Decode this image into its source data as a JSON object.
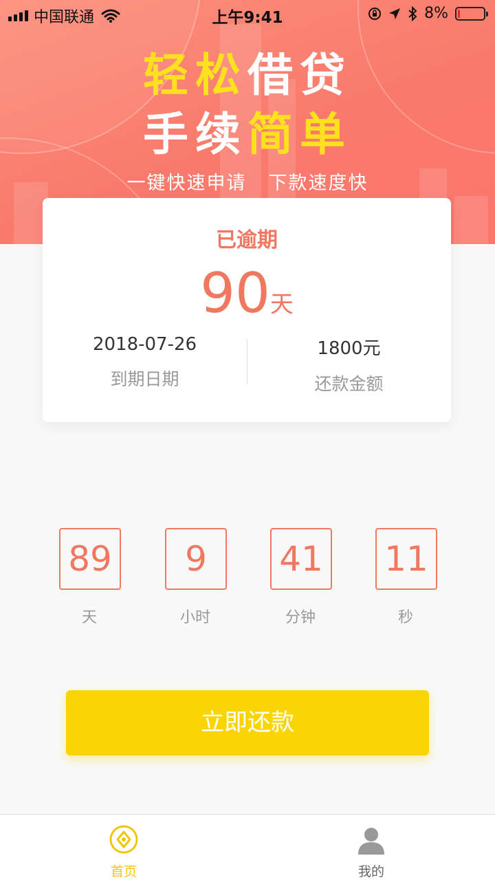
{
  "status_bar": {
    "carrier": "中国联通",
    "time": "上午9:41",
    "battery": "8%",
    "battery_level": 0.08,
    "icons": [
      "signal-icon",
      "wifi-icon",
      "lock-rotation-icon",
      "location-icon",
      "bluetooth-icon",
      "battery-icon"
    ]
  },
  "hero": {
    "line1": [
      "轻",
      "松",
      "借",
      "贷"
    ],
    "line2": [
      "手",
      "续",
      "简",
      "单"
    ],
    "subtitle_left": "一键快速申请",
    "subtitle_right": "下款速度快"
  },
  "loan_card": {
    "status": "已逾期",
    "overdue_days": "90",
    "days_unit": "天",
    "due_date": "2018-07-26",
    "due_date_label": "到期日期",
    "amount": "1800元",
    "amount_label": "还款金额"
  },
  "countdown": [
    {
      "value": "89",
      "label": "天"
    },
    {
      "value": "9",
      "label": "小时"
    },
    {
      "value": "41",
      "label": "分钟"
    },
    {
      "value": "11",
      "label": "秒"
    }
  ],
  "repay_button": "立即还款",
  "tabs": [
    {
      "label": "首页",
      "icon": "home-coin-icon",
      "active": true
    },
    {
      "label": "我的",
      "icon": "user-icon",
      "active": false
    }
  ],
  "colors": {
    "accent": "#f07860",
    "button": "#f9d603",
    "hero": "#fa7d6e",
    "highlight": "#fee11e"
  }
}
